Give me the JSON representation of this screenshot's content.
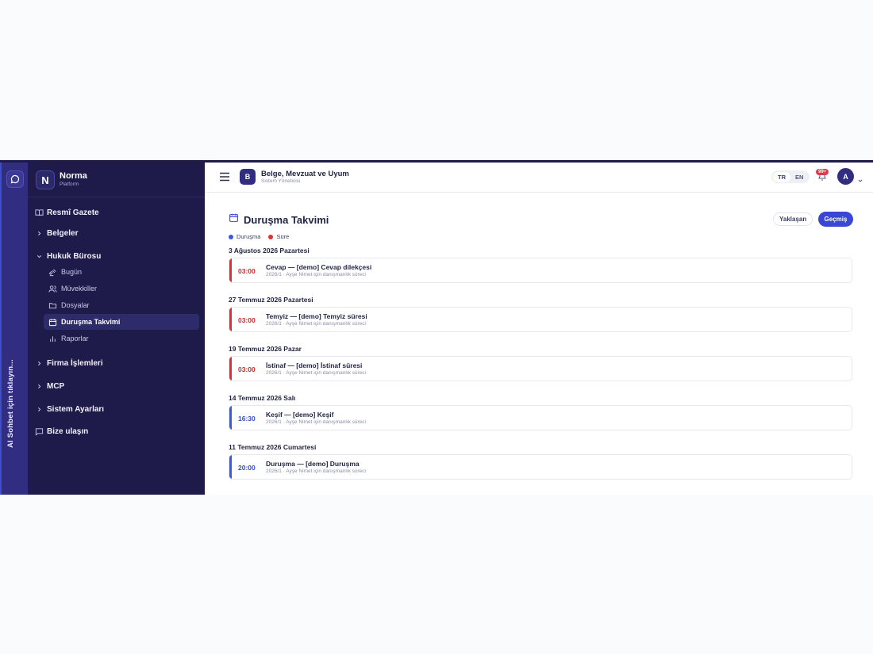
{
  "rail": {
    "label": "AI Sohbet için tıklayın..."
  },
  "brand": {
    "initial": "N",
    "name": "Norma",
    "sub": "Platform"
  },
  "sidebar": {
    "resmi": "Resmî Gazete",
    "belgeler": "Belgeler",
    "hukuk": "Hukuk Bürosu",
    "sub": [
      "Bugün",
      "Müvekkiller",
      "Dosyalar",
      "Duruşma Takvimi",
      "Raporlar"
    ],
    "firma": "Firma İşlemleri",
    "mcp": "MCP",
    "ayarlar": "Sistem Ayarları",
    "bize": "Bize ulaşın"
  },
  "header": {
    "logo": "B",
    "title": "Belge, Mevzuat ve Uyum",
    "subtitle": "Sistem Yöneticisi",
    "lang_tr": "TR",
    "lang_en": "EN",
    "badge": "99+",
    "avatar": "A"
  },
  "page": {
    "title": "Duruşma Takvimi",
    "btn_upcoming": "Yaklaşan",
    "btn_past": "Geçmiş",
    "legend": [
      {
        "label": "Duruşma",
        "color": "#3b5bdb"
      },
      {
        "label": "Süre",
        "color": "#e03131"
      }
    ]
  },
  "days": [
    {
      "label": "3 Ağustos 2026 Pazartesi",
      "time": "03:00",
      "title": "Cevap — [demo] Cevap dilekçesi",
      "meta": "2026/1 · Ayşe Nimet için danışmanlık süreci",
      "color": "#e03131"
    },
    {
      "label": "27 Temmuz 2026 Pazartesi",
      "time": "03:00",
      "title": "Temyiz — [demo] Temyiz süresi",
      "meta": "2026/1 · Ayşe Nimet için danışmanlık süreci",
      "color": "#e03131"
    },
    {
      "label": "19 Temmuz 2026 Pazar",
      "time": "03:00",
      "title": "İstinaf — [demo] İstinaf süresi",
      "meta": "2026/1 · Ayşe Nimet için danışmanlık süreci",
      "color": "#e03131"
    },
    {
      "label": "14 Temmuz 2026 Salı",
      "time": "16:30",
      "title": "Keşif — [demo] Keşif",
      "meta": "2026/1 · Ayşe Nimet için danışmanlık süreci",
      "color": "#3b5bdb"
    },
    {
      "label": "11 Temmuz 2026 Cumartesi",
      "time": "20:00",
      "title": "Duruşma — [demo] Duruşma",
      "meta": "2026/1 · Ayşe Nimet için danışmanlık süreci",
      "color": "#3b5bdb"
    }
  ]
}
